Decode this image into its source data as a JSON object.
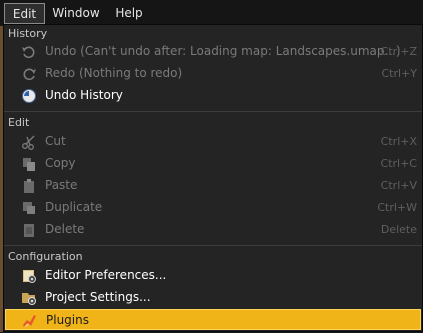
{
  "menubar": {
    "items": [
      {
        "label": "Edit"
      },
      {
        "label": "Window"
      },
      {
        "label": "Help"
      }
    ]
  },
  "dropdown": {
    "sections": {
      "history": {
        "header": "History",
        "items": [
          {
            "label": "Undo (Can't undo after: Loading map: Landscapes.umap...)",
            "shortcut": "Ctrl+Z",
            "icon": "undo-icon",
            "enabled": false
          },
          {
            "label": "Redo (Nothing to redo)",
            "shortcut": "Ctrl+Y",
            "icon": "redo-icon",
            "enabled": false
          },
          {
            "label": "Undo History",
            "shortcut": "",
            "icon": "undo-history-icon",
            "enabled": true
          }
        ]
      },
      "edit": {
        "header": "Edit",
        "items": [
          {
            "label": "Cut",
            "shortcut": "Ctrl+X",
            "icon": "scissors-icon",
            "enabled": false
          },
          {
            "label": "Copy",
            "shortcut": "Ctrl+C",
            "icon": "copy-icon",
            "enabled": false
          },
          {
            "label": "Paste",
            "shortcut": "Ctrl+V",
            "icon": "paste-icon",
            "enabled": false
          },
          {
            "label": "Duplicate",
            "shortcut": "Ctrl+W",
            "icon": "duplicate-icon",
            "enabled": false
          },
          {
            "label": "Delete",
            "shortcut": "Delete",
            "icon": "delete-icon",
            "enabled": false
          }
        ]
      },
      "configuration": {
        "header": "Configuration",
        "items": [
          {
            "label": "Editor Preferences...",
            "shortcut": "",
            "icon": "editor-preferences-icon",
            "enabled": true
          },
          {
            "label": "Project Settings...",
            "shortcut": "",
            "icon": "project-settings-icon",
            "enabled": true
          },
          {
            "label": "Plugins",
            "shortcut": "",
            "icon": "plugins-icon",
            "enabled": true,
            "selected": true
          }
        ]
      }
    }
  },
  "colors": {
    "menu_bg": "#242424",
    "highlight": "#f0b419",
    "disabled_text": "#7a7a7a",
    "enabled_text": "#ffffff"
  }
}
